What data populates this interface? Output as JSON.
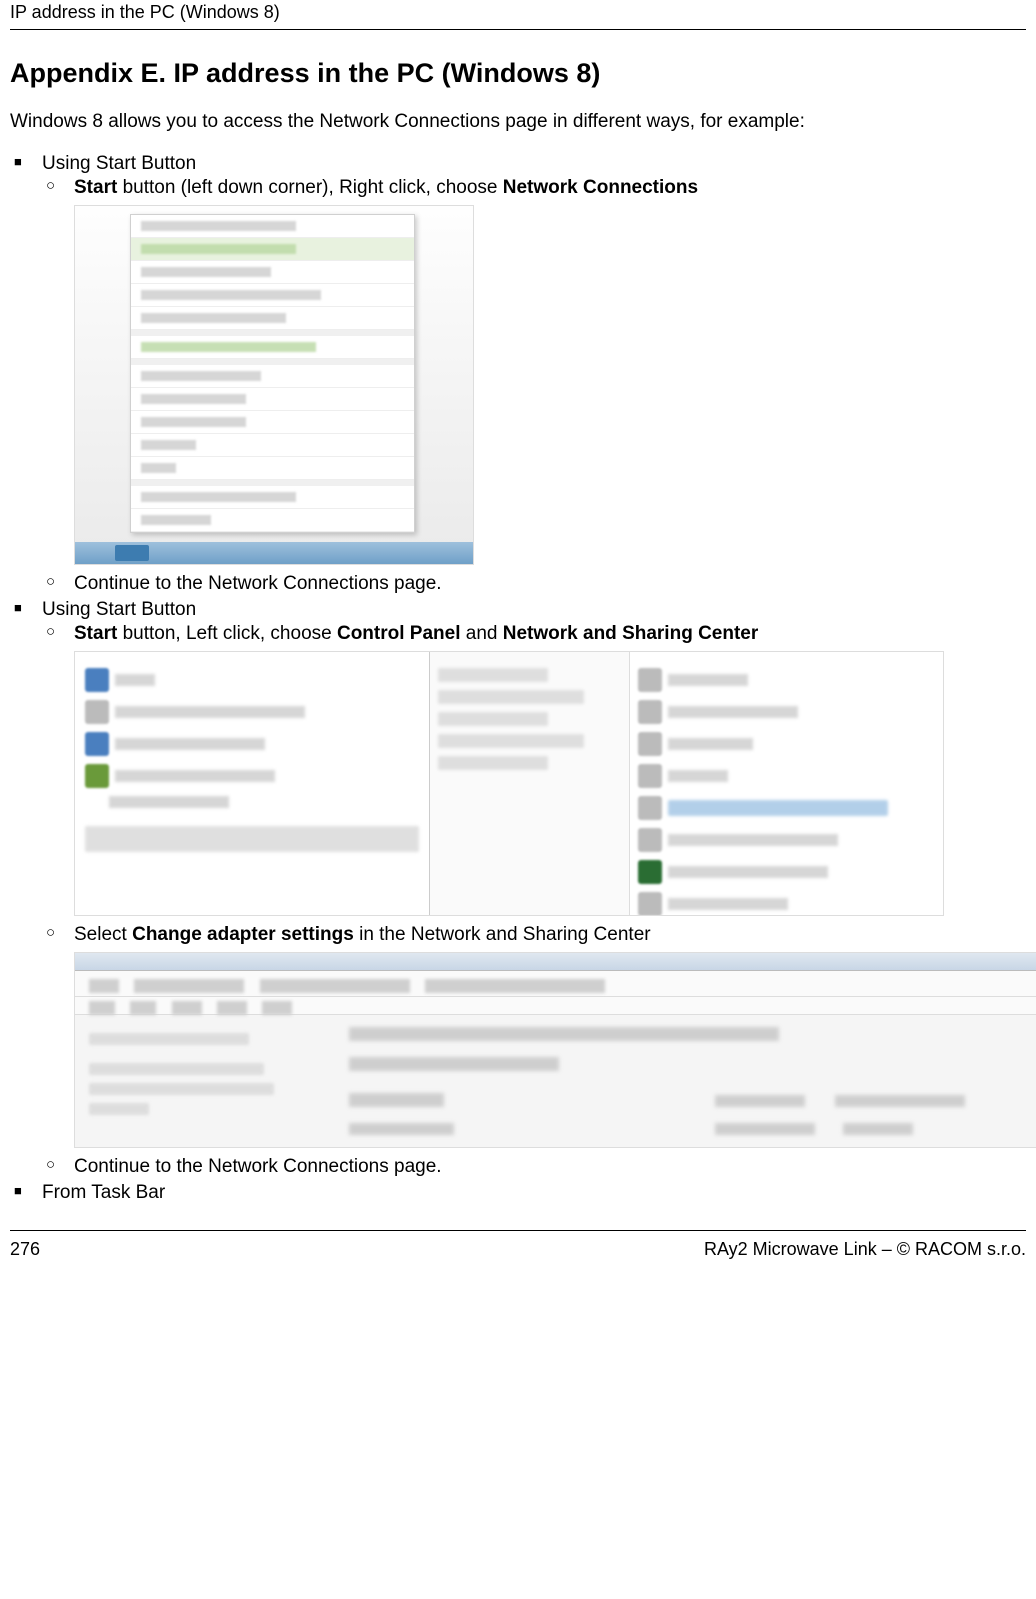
{
  "header": {
    "running_title": "IP address in the PC (Windows 8)"
  },
  "title": "Appendix E. IP address in the PC (Windows 8)",
  "intro": "Windows 8 allows you to access the Network Connections page in different ways, for example:",
  "sections": [
    {
      "label": "Using Start Button",
      "steps": [
        {
          "prefix": "Start",
          "mid": " button (left down corner), Right click, choose ",
          "bold2": "Network Connections",
          "suffix": ""
        },
        {
          "text": "Continue to the Network Connections page."
        }
      ]
    },
    {
      "label": "Using Start Button",
      "steps": [
        {
          "prefix": "Start",
          "mid": " button, Left click, choose ",
          "bold2": "Control Panel",
          "mid2": " and ",
          "bold3": "Network and Sharing Center",
          "suffix": ""
        },
        {
          "pre_text": "Select ",
          "bold": "Change adapter settings",
          "post_text": " in the Network and Sharing Center"
        },
        {
          "text": "Continue to the Network Connections page."
        }
      ]
    },
    {
      "label": "From Task Bar",
      "steps": []
    }
  ],
  "footer": {
    "page": "276",
    "right": "RAy2 Microwave Link – © RACOM s.r.o."
  }
}
